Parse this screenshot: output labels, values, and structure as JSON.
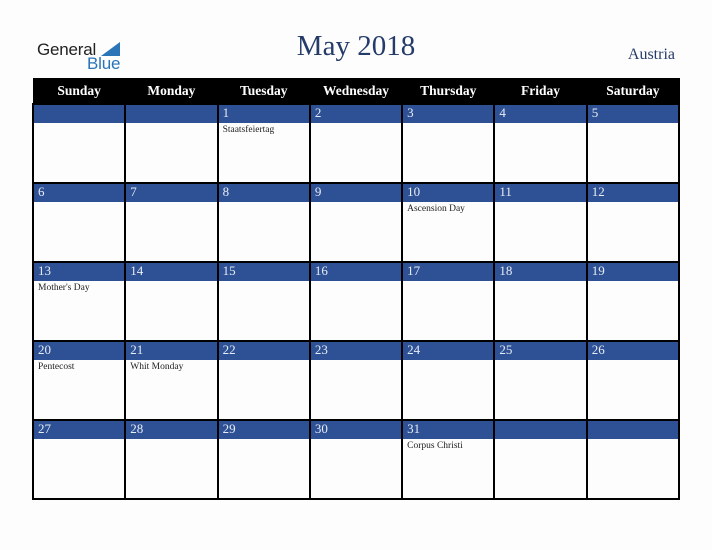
{
  "logo": {
    "line1": "General",
    "line2": "Blue",
    "accent_color": "#2a74b8"
  },
  "header": {
    "title": "May 2018",
    "country": "Austria"
  },
  "colors": {
    "header_bg": "#000000",
    "date_bar_bg": "#2d5194",
    "title_color": "#253c6a"
  },
  "weekdays": [
    "Sunday",
    "Monday",
    "Tuesday",
    "Wednesday",
    "Thursday",
    "Friday",
    "Saturday"
  ],
  "weeks": [
    [
      {
        "day": "",
        "event": ""
      },
      {
        "day": "",
        "event": ""
      },
      {
        "day": "1",
        "event": "Staatsfeiertag"
      },
      {
        "day": "2",
        "event": ""
      },
      {
        "day": "3",
        "event": ""
      },
      {
        "day": "4",
        "event": ""
      },
      {
        "day": "5",
        "event": ""
      }
    ],
    [
      {
        "day": "6",
        "event": ""
      },
      {
        "day": "7",
        "event": ""
      },
      {
        "day": "8",
        "event": ""
      },
      {
        "day": "9",
        "event": ""
      },
      {
        "day": "10",
        "event": "Ascension Day"
      },
      {
        "day": "11",
        "event": ""
      },
      {
        "day": "12",
        "event": ""
      }
    ],
    [
      {
        "day": "13",
        "event": "Mother's Day"
      },
      {
        "day": "14",
        "event": ""
      },
      {
        "day": "15",
        "event": ""
      },
      {
        "day": "16",
        "event": ""
      },
      {
        "day": "17",
        "event": ""
      },
      {
        "day": "18",
        "event": ""
      },
      {
        "day": "19",
        "event": ""
      }
    ],
    [
      {
        "day": "20",
        "event": "Pentecost"
      },
      {
        "day": "21",
        "event": "Whit Monday"
      },
      {
        "day": "22",
        "event": ""
      },
      {
        "day": "23",
        "event": ""
      },
      {
        "day": "24",
        "event": ""
      },
      {
        "day": "25",
        "event": ""
      },
      {
        "day": "26",
        "event": ""
      }
    ],
    [
      {
        "day": "27",
        "event": ""
      },
      {
        "day": "28",
        "event": ""
      },
      {
        "day": "29",
        "event": ""
      },
      {
        "day": "30",
        "event": ""
      },
      {
        "day": "31",
        "event": "Corpus Christi"
      },
      {
        "day": "",
        "event": ""
      },
      {
        "day": "",
        "event": ""
      }
    ]
  ]
}
